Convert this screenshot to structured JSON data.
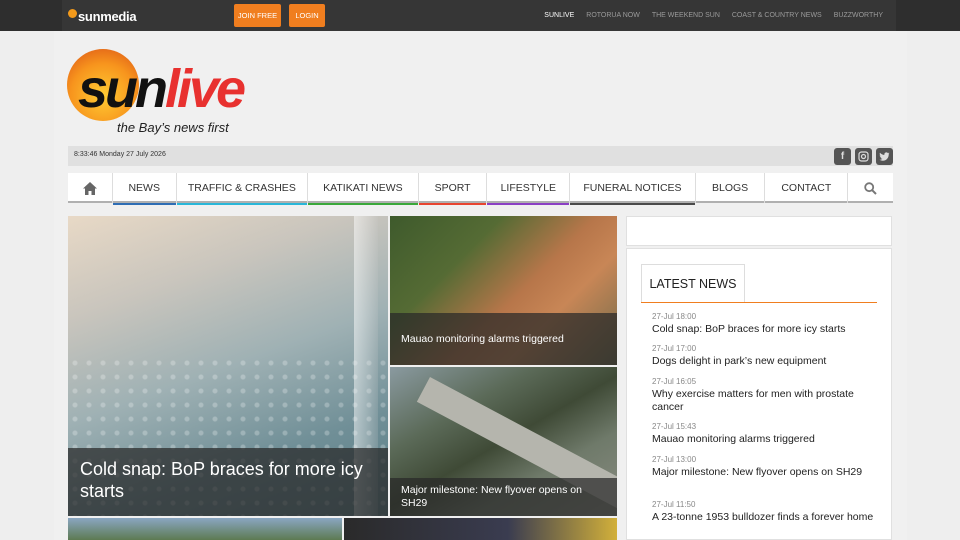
{
  "topbar": {
    "logo_text": "sunmedia",
    "logo_tag": "",
    "join_label": "JOIN FREE",
    "login_label": "LOGIN",
    "links": [
      "SUNLIVE",
      "ROTORUA NOW",
      "THE WEEKEND SUN",
      "COAST & COUNTRY NEWS",
      "BUZZWORTHY"
    ],
    "active_link": "SUNLIVE"
  },
  "logo": {
    "word_a": "sun",
    "word_b": "live",
    "tagline": "the Bay’s news first"
  },
  "datebar": {
    "datetime": "8:33:46 Monday 27 July 2026",
    "social": [
      "facebook-icon",
      "instagram-icon",
      "twitter-icon"
    ]
  },
  "nav": {
    "items": [
      {
        "label": "NEWS",
        "color": "#2e6db4"
      },
      {
        "label": "TRAFFIC & CRASHES",
        "color": "#29b6d8"
      },
      {
        "label": "KATIKATI NEWS",
        "color": "#3aa83a"
      },
      {
        "label": "SPORT",
        "color": "#e8442f"
      },
      {
        "label": "LIFESTYLE",
        "color": "#8b3fc4"
      },
      {
        "label": "FUNERAL NOTICES",
        "color": "#4a4a4a"
      },
      {
        "label": "BLOGS",
        "color": "#cccccc"
      },
      {
        "label": "CONTACT",
        "color": "#cccccc"
      }
    ]
  },
  "stories": {
    "hero": "Cold snap: BoP braces for more icy starts",
    "tile1": "Mauao monitoring alarms triggered",
    "tile2": "Major milestone: New flyover opens on SH29"
  },
  "latest": {
    "heading": "LATEST NEWS",
    "items": [
      {
        "time": "27-Jul 18:00",
        "title": "Cold snap: BoP braces for more icy starts"
      },
      {
        "time": "27-Jul 17:00",
        "title": "Dogs delight in park’s new equipment"
      },
      {
        "time": "27-Jul 16:05",
        "title": "Why exercise matters for men with prostate cancer"
      },
      {
        "time": "27-Jul 15:43",
        "title": "Mauao monitoring alarms triggered"
      },
      {
        "time": "27-Jul 13:00",
        "title": "Major milestone: New flyover opens on SH29"
      },
      {
        "time": "27-Jul 11:50",
        "title": "A 23-tonne 1953 bulldozer finds a forever home"
      }
    ]
  },
  "colors": {
    "accent": "#f07e1f",
    "brand_red": "#e8312f"
  }
}
